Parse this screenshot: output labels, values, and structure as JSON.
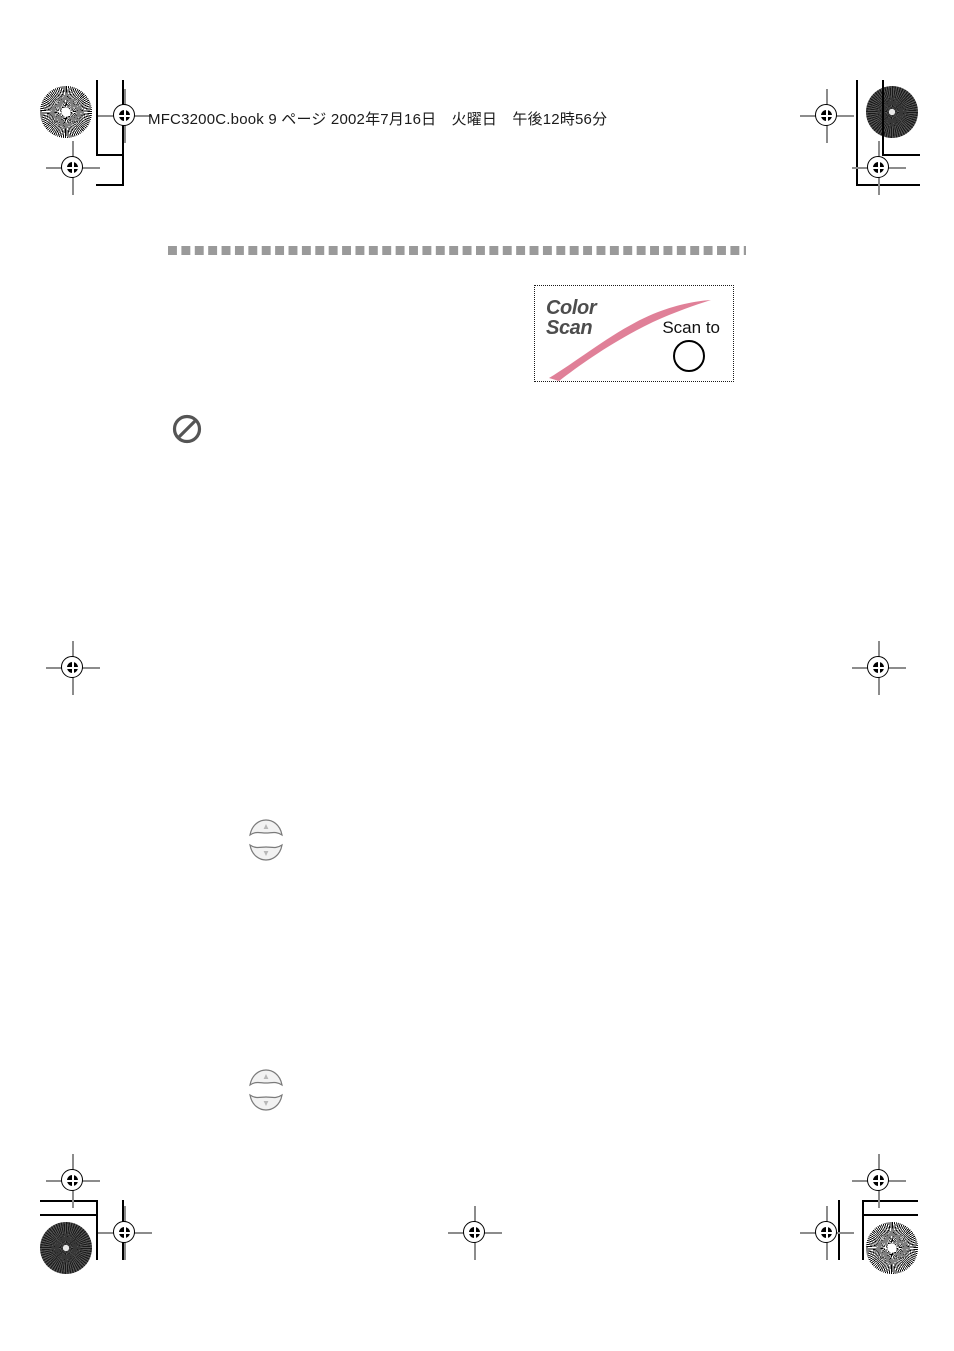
{
  "document": {
    "header_line": "MFC3200C.book 9 ページ 2002年7月16日　火曜日　午後12時56分",
    "file_name": "MFC3200C.book",
    "page_number": "9",
    "page_unit": "ページ",
    "date": "2002年7月16日",
    "weekday": "火曜日",
    "time": "午後12時56分"
  },
  "divider": {
    "name": "section-divider"
  },
  "logo": {
    "title_line1": "Color",
    "title_line2": "Scan",
    "scan_to_label": "Scan to",
    "title_color": "#4d4d4d",
    "swoosh_color": "#e08098",
    "border_color": "#1a1a1a",
    "button_color": "#000000"
  },
  "icons": {
    "prohibition": "no-entry-icon",
    "prohibition_color": "#555555",
    "nav_up": "navigation-up-key",
    "nav_down": "navigation-down-key",
    "key_fill": "#f2f2f2",
    "key_stroke": "#7a7a7a"
  },
  "print_marks": {
    "registration": "registration-target",
    "halftone_light": "halftone-starburst-light",
    "halftone_dark": "halftone-starburst-dark",
    "crop": "crop-mark",
    "reg_color": "#8c8c8c",
    "crop_color": "#000000"
  }
}
